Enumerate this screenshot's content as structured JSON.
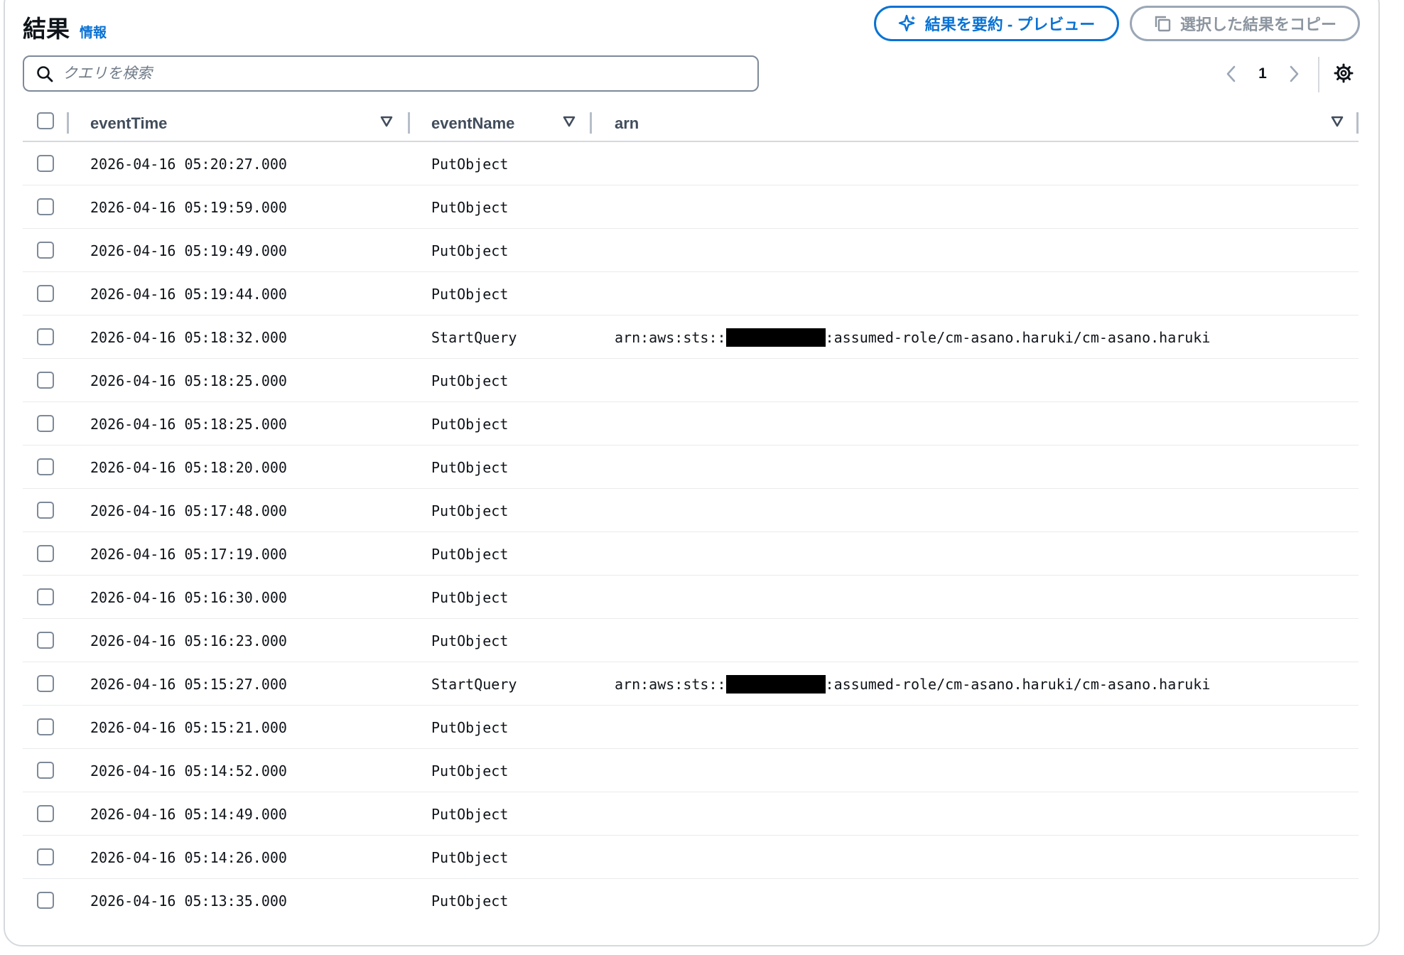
{
  "header": {
    "title": "結果",
    "info": "情報"
  },
  "actions": {
    "summary_label": "結果を要約 - プレビュー",
    "copy_label": "選択した結果をコピー"
  },
  "search": {
    "placeholder": "クエリを検索"
  },
  "pagination": {
    "current_page": "1"
  },
  "columns": [
    "eventTime",
    "eventName",
    "arn"
  ],
  "rows": [
    {
      "eventTime": "2026-04-16 05:20:27.000",
      "eventName": "PutObject",
      "arn_prefix": "",
      "arn_suffix": ""
    },
    {
      "eventTime": "2026-04-16 05:19:59.000",
      "eventName": "PutObject",
      "arn_prefix": "",
      "arn_suffix": ""
    },
    {
      "eventTime": "2026-04-16 05:19:49.000",
      "eventName": "PutObject",
      "arn_prefix": "",
      "arn_suffix": ""
    },
    {
      "eventTime": "2026-04-16 05:19:44.000",
      "eventName": "PutObject",
      "arn_prefix": "",
      "arn_suffix": ""
    },
    {
      "eventTime": "2026-04-16 05:18:32.000",
      "eventName": "StartQuery",
      "arn_prefix": "arn:aws:sts::",
      "arn_suffix": ":assumed-role/cm-asano.haruki/cm-asano.haruki"
    },
    {
      "eventTime": "2026-04-16 05:18:25.000",
      "eventName": "PutObject",
      "arn_prefix": "",
      "arn_suffix": ""
    },
    {
      "eventTime": "2026-04-16 05:18:25.000",
      "eventName": "PutObject",
      "arn_prefix": "",
      "arn_suffix": ""
    },
    {
      "eventTime": "2026-04-16 05:18:20.000",
      "eventName": "PutObject",
      "arn_prefix": "",
      "arn_suffix": ""
    },
    {
      "eventTime": "2026-04-16 05:17:48.000",
      "eventName": "PutObject",
      "arn_prefix": "",
      "arn_suffix": ""
    },
    {
      "eventTime": "2026-04-16 05:17:19.000",
      "eventName": "PutObject",
      "arn_prefix": "",
      "arn_suffix": ""
    },
    {
      "eventTime": "2026-04-16 05:16:30.000",
      "eventName": "PutObject",
      "arn_prefix": "",
      "arn_suffix": ""
    },
    {
      "eventTime": "2026-04-16 05:16:23.000",
      "eventName": "PutObject",
      "arn_prefix": "",
      "arn_suffix": ""
    },
    {
      "eventTime": "2026-04-16 05:15:27.000",
      "eventName": "StartQuery",
      "arn_prefix": "arn:aws:sts::",
      "arn_suffix": ":assumed-role/cm-asano.haruki/cm-asano.haruki"
    },
    {
      "eventTime": "2026-04-16 05:15:21.000",
      "eventName": "PutObject",
      "arn_prefix": "",
      "arn_suffix": ""
    },
    {
      "eventTime": "2026-04-16 05:14:52.000",
      "eventName": "PutObject",
      "arn_prefix": "",
      "arn_suffix": ""
    },
    {
      "eventTime": "2026-04-16 05:14:49.000",
      "eventName": "PutObject",
      "arn_prefix": "",
      "arn_suffix": ""
    },
    {
      "eventTime": "2026-04-16 05:14:26.000",
      "eventName": "PutObject",
      "arn_prefix": "",
      "arn_suffix": ""
    },
    {
      "eventTime": "2026-04-16 05:13:35.000",
      "eventName": "PutObject",
      "arn_prefix": "",
      "arn_suffix": ""
    }
  ],
  "colors": {
    "accent": "#0972d3",
    "border": "#d5d9dd",
    "text": "#0f141a",
    "muted": "#414d5c"
  },
  "icons": {
    "summary": "sparkle-icon",
    "copy": "copy-icon",
    "search": "search-icon",
    "prev": "chevron-left-icon",
    "next": "chevron-right-icon",
    "settings": "gear-icon",
    "sort": "sort-caret-icon"
  }
}
